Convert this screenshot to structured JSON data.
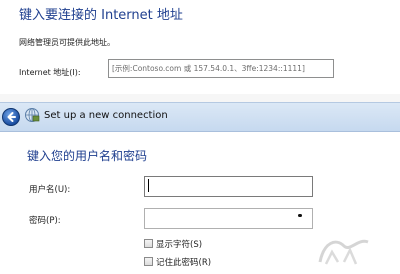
{
  "address_dialog": {
    "title": "键入要连接的 Internet 地址",
    "description": "网络管理员可提供此地址。",
    "address_label": "Internet 地址(I):",
    "address_placeholder": "[示例:Contoso.com 或 157.54.0.1、3ffe:1234::1111]"
  },
  "header": {
    "back_icon": "back-arrow-icon",
    "network_icon": "network-connection-icon",
    "title": "Set up a new connection"
  },
  "credentials": {
    "title": "键入您的用户名和密码",
    "username_label": "用户名(U):",
    "username_value": "",
    "password_label": "密码(P):",
    "show_characters_label": "显示字符(S)",
    "remember_password_label": "记住此密码(R)"
  },
  "colors": {
    "heading_blue": "#1f3f8f",
    "header_band": "#c6d9ef",
    "back_button": "#1b4fa3"
  }
}
